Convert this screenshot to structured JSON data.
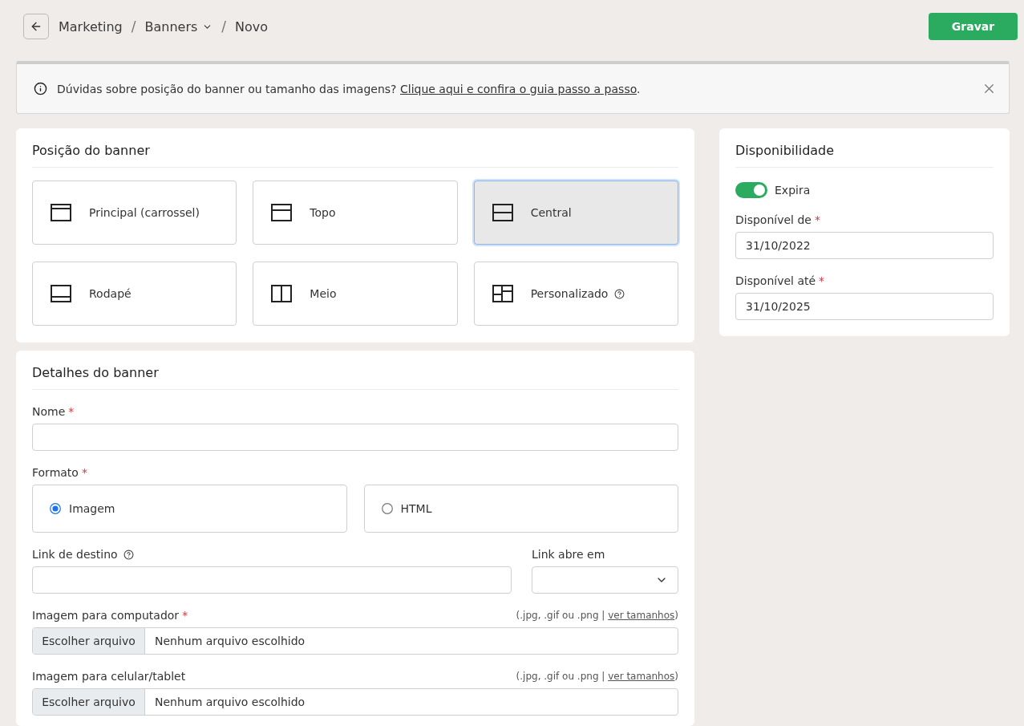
{
  "header": {
    "breadcrumbs": [
      {
        "label": "Marketing",
        "has_menu": false
      },
      {
        "separator": "/",
        "label": "Banners",
        "has_menu": true
      },
      {
        "separator": "/",
        "label": "Novo",
        "has_menu": false
      }
    ],
    "save_button": "Gravar"
  },
  "notice": {
    "text": "Dúvidas sobre posição do banner ou tamanho das imagens? ",
    "link": "Clique aqui e confira o guia passo a passo",
    "end": "."
  },
  "position": {
    "title": "Posição do banner",
    "options": [
      {
        "label": "Principal (carrossel)",
        "kind": "carousel",
        "selected": false,
        "help": false
      },
      {
        "label": "Topo",
        "kind": "top",
        "selected": false,
        "help": false
      },
      {
        "label": "Central",
        "kind": "center",
        "selected": true,
        "help": false
      },
      {
        "label": "Rodapé",
        "kind": "footer",
        "selected": false,
        "help": false
      },
      {
        "label": "Meio",
        "kind": "middle",
        "selected": false,
        "help": false
      },
      {
        "label": "Personalizado",
        "kind": "custom",
        "selected": false,
        "help": true
      }
    ]
  },
  "details": {
    "title": "Detalhes do banner",
    "name": {
      "label": "Nome",
      "required_mark": "*"
    },
    "format": {
      "label": "Formato",
      "required_mark": "*",
      "options": [
        {
          "label": "Imagem",
          "selected": true
        },
        {
          "label": "HTML",
          "selected": false
        }
      ]
    },
    "link": {
      "label": "Link de destino",
      "help": true
    },
    "link_target": {
      "label": "Link abre em"
    },
    "uploads": [
      {
        "label": "Imagem para computador",
        "required_mark": "*",
        "hint": {
          "before": "(.jpg, .gif ou .png | ",
          "link": "ver tamanhos",
          "after": ")"
        },
        "button": "Escolher arquivo",
        "status": "Nenhum arquivo escolhido"
      },
      {
        "label": "Imagem para celular/tablet",
        "hint": {
          "before": "(.jpg, .gif ou .png | ",
          "link": "ver tamanhos",
          "after": ")"
        },
        "button": "Escolher arquivo",
        "status": "Nenhum arquivo escolhido"
      }
    ]
  },
  "availability": {
    "title": "Disponibilidade",
    "expires": {
      "label": "Expira",
      "on": true
    },
    "fields": [
      {
        "label": "Disponível de",
        "required_mark": "*",
        "value": "31/10/2022"
      },
      {
        "label": "Disponível até",
        "required_mark": "*",
        "value": "31/10/2025"
      }
    ]
  }
}
